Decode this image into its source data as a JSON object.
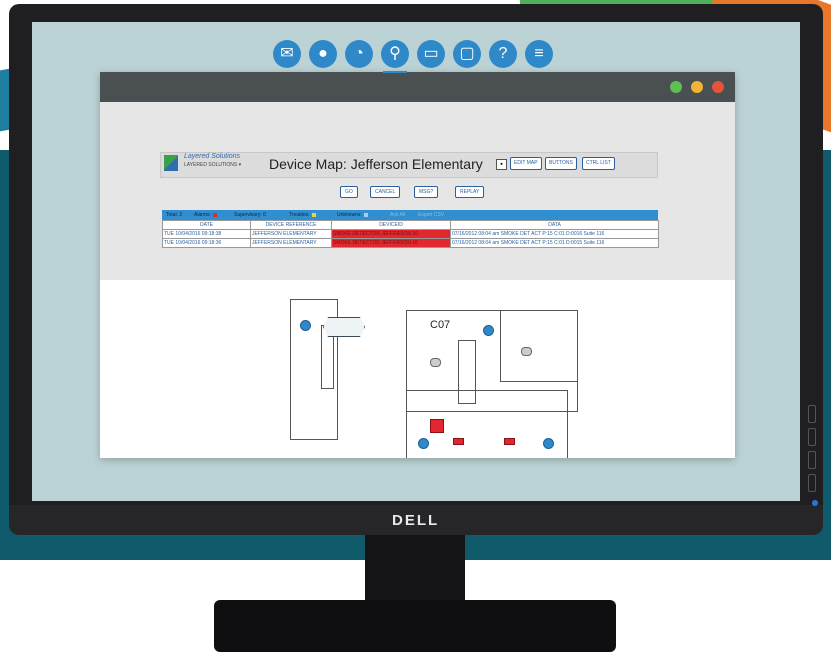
{
  "monitor": {
    "brand": "DELL"
  },
  "app": {
    "toolbar": {
      "icons": [
        "envelope-icon",
        "user-icon",
        "chat-icon",
        "map-pin-icon",
        "inbox-icon",
        "lock-icon",
        "help-icon",
        "menu-icon"
      ],
      "active_index": 3
    },
    "header": {
      "logo_title": "Layered Solutions",
      "logo_sub": "LAYERED SOLUTIONS ▾",
      "page_title": "Device Map: Jefferson Elementary",
      "buttons": [
        "EDIT MAP",
        "BUTTONS",
        "CTRL LIST"
      ]
    },
    "actions": [
      "GO",
      "CANCEL",
      "MSG?",
      "REPLAY"
    ],
    "status": {
      "total": "Total: 2",
      "alarms": "Alarms:",
      "supervisory": "Supervisory: 0",
      "troubles": "Troubles:",
      "unknowns": "Unknowns:",
      "ack_all": "Ack All",
      "export_csv": "Export CSV"
    },
    "table": {
      "columns": [
        "DATE",
        "DEVICE REFERENCE",
        "DEVICEID",
        "DATA"
      ],
      "rows": [
        [
          "TUE 10/04/2016 09:18:38",
          "JEFFERSON ELEMENTARY",
          "SMOKE DETECTOR JEFFERSON 16",
          "07/16/2012 08:04 am SMOKE DET ACT P:15 C:01 D:0016 Suite 116"
        ],
        [
          "TUE 10/04/2016 09:18:36",
          "JEFFERSON ELEMENTARY",
          "SMOKE DETECTOR JEFFERSON 16",
          "07/16/2012 08:04 am SMOKE DET ACT P:15 C:01 D:0015 Suite 116"
        ]
      ]
    },
    "map": {
      "room_label": "C07"
    },
    "colors": {
      "accent": "#2f89c9",
      "alarm": "#e0282e",
      "titlebar": "#4a4f52"
    }
  }
}
